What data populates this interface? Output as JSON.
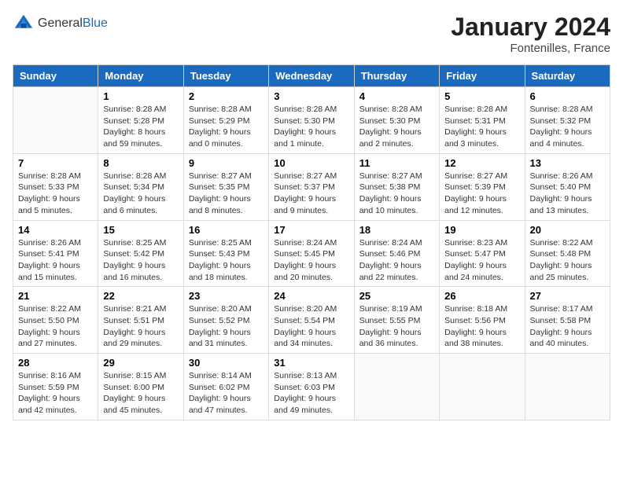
{
  "header": {
    "logo_general": "General",
    "logo_blue": "Blue",
    "month_year": "January 2024",
    "location": "Fontenilles, France"
  },
  "weekdays": [
    "Sunday",
    "Monday",
    "Tuesday",
    "Wednesday",
    "Thursday",
    "Friday",
    "Saturday"
  ],
  "weeks": [
    [
      {
        "day": "",
        "sunrise": "",
        "sunset": "",
        "daylight": ""
      },
      {
        "day": "1",
        "sunrise": "Sunrise: 8:28 AM",
        "sunset": "Sunset: 5:28 PM",
        "daylight": "Daylight: 8 hours and 59 minutes."
      },
      {
        "day": "2",
        "sunrise": "Sunrise: 8:28 AM",
        "sunset": "Sunset: 5:29 PM",
        "daylight": "Daylight: 9 hours and 0 minutes."
      },
      {
        "day": "3",
        "sunrise": "Sunrise: 8:28 AM",
        "sunset": "Sunset: 5:30 PM",
        "daylight": "Daylight: 9 hours and 1 minute."
      },
      {
        "day": "4",
        "sunrise": "Sunrise: 8:28 AM",
        "sunset": "Sunset: 5:30 PM",
        "daylight": "Daylight: 9 hours and 2 minutes."
      },
      {
        "day": "5",
        "sunrise": "Sunrise: 8:28 AM",
        "sunset": "Sunset: 5:31 PM",
        "daylight": "Daylight: 9 hours and 3 minutes."
      },
      {
        "day": "6",
        "sunrise": "Sunrise: 8:28 AM",
        "sunset": "Sunset: 5:32 PM",
        "daylight": "Daylight: 9 hours and 4 minutes."
      }
    ],
    [
      {
        "day": "7",
        "sunrise": "Sunrise: 8:28 AM",
        "sunset": "Sunset: 5:33 PM",
        "daylight": "Daylight: 9 hours and 5 minutes."
      },
      {
        "day": "8",
        "sunrise": "Sunrise: 8:28 AM",
        "sunset": "Sunset: 5:34 PM",
        "daylight": "Daylight: 9 hours and 6 minutes."
      },
      {
        "day": "9",
        "sunrise": "Sunrise: 8:27 AM",
        "sunset": "Sunset: 5:35 PM",
        "daylight": "Daylight: 9 hours and 8 minutes."
      },
      {
        "day": "10",
        "sunrise": "Sunrise: 8:27 AM",
        "sunset": "Sunset: 5:37 PM",
        "daylight": "Daylight: 9 hours and 9 minutes."
      },
      {
        "day": "11",
        "sunrise": "Sunrise: 8:27 AM",
        "sunset": "Sunset: 5:38 PM",
        "daylight": "Daylight: 9 hours and 10 minutes."
      },
      {
        "day": "12",
        "sunrise": "Sunrise: 8:27 AM",
        "sunset": "Sunset: 5:39 PM",
        "daylight": "Daylight: 9 hours and 12 minutes."
      },
      {
        "day": "13",
        "sunrise": "Sunrise: 8:26 AM",
        "sunset": "Sunset: 5:40 PM",
        "daylight": "Daylight: 9 hours and 13 minutes."
      }
    ],
    [
      {
        "day": "14",
        "sunrise": "Sunrise: 8:26 AM",
        "sunset": "Sunset: 5:41 PM",
        "daylight": "Daylight: 9 hours and 15 minutes."
      },
      {
        "day": "15",
        "sunrise": "Sunrise: 8:25 AM",
        "sunset": "Sunset: 5:42 PM",
        "daylight": "Daylight: 9 hours and 16 minutes."
      },
      {
        "day": "16",
        "sunrise": "Sunrise: 8:25 AM",
        "sunset": "Sunset: 5:43 PM",
        "daylight": "Daylight: 9 hours and 18 minutes."
      },
      {
        "day": "17",
        "sunrise": "Sunrise: 8:24 AM",
        "sunset": "Sunset: 5:45 PM",
        "daylight": "Daylight: 9 hours and 20 minutes."
      },
      {
        "day": "18",
        "sunrise": "Sunrise: 8:24 AM",
        "sunset": "Sunset: 5:46 PM",
        "daylight": "Daylight: 9 hours and 22 minutes."
      },
      {
        "day": "19",
        "sunrise": "Sunrise: 8:23 AM",
        "sunset": "Sunset: 5:47 PM",
        "daylight": "Daylight: 9 hours and 24 minutes."
      },
      {
        "day": "20",
        "sunrise": "Sunrise: 8:22 AM",
        "sunset": "Sunset: 5:48 PM",
        "daylight": "Daylight: 9 hours and 25 minutes."
      }
    ],
    [
      {
        "day": "21",
        "sunrise": "Sunrise: 8:22 AM",
        "sunset": "Sunset: 5:50 PM",
        "daylight": "Daylight: 9 hours and 27 minutes."
      },
      {
        "day": "22",
        "sunrise": "Sunrise: 8:21 AM",
        "sunset": "Sunset: 5:51 PM",
        "daylight": "Daylight: 9 hours and 29 minutes."
      },
      {
        "day": "23",
        "sunrise": "Sunrise: 8:20 AM",
        "sunset": "Sunset: 5:52 PM",
        "daylight": "Daylight: 9 hours and 31 minutes."
      },
      {
        "day": "24",
        "sunrise": "Sunrise: 8:20 AM",
        "sunset": "Sunset: 5:54 PM",
        "daylight": "Daylight: 9 hours and 34 minutes."
      },
      {
        "day": "25",
        "sunrise": "Sunrise: 8:19 AM",
        "sunset": "Sunset: 5:55 PM",
        "daylight": "Daylight: 9 hours and 36 minutes."
      },
      {
        "day": "26",
        "sunrise": "Sunrise: 8:18 AM",
        "sunset": "Sunset: 5:56 PM",
        "daylight": "Daylight: 9 hours and 38 minutes."
      },
      {
        "day": "27",
        "sunrise": "Sunrise: 8:17 AM",
        "sunset": "Sunset: 5:58 PM",
        "daylight": "Daylight: 9 hours and 40 minutes."
      }
    ],
    [
      {
        "day": "28",
        "sunrise": "Sunrise: 8:16 AM",
        "sunset": "Sunset: 5:59 PM",
        "daylight": "Daylight: 9 hours and 42 minutes."
      },
      {
        "day": "29",
        "sunrise": "Sunrise: 8:15 AM",
        "sunset": "Sunset: 6:00 PM",
        "daylight": "Daylight: 9 hours and 45 minutes."
      },
      {
        "day": "30",
        "sunrise": "Sunrise: 8:14 AM",
        "sunset": "Sunset: 6:02 PM",
        "daylight": "Daylight: 9 hours and 47 minutes."
      },
      {
        "day": "31",
        "sunrise": "Sunrise: 8:13 AM",
        "sunset": "Sunset: 6:03 PM",
        "daylight": "Daylight: 9 hours and 49 minutes."
      },
      {
        "day": "",
        "sunrise": "",
        "sunset": "",
        "daylight": ""
      },
      {
        "day": "",
        "sunrise": "",
        "sunset": "",
        "daylight": ""
      },
      {
        "day": "",
        "sunrise": "",
        "sunset": "",
        "daylight": ""
      }
    ]
  ]
}
